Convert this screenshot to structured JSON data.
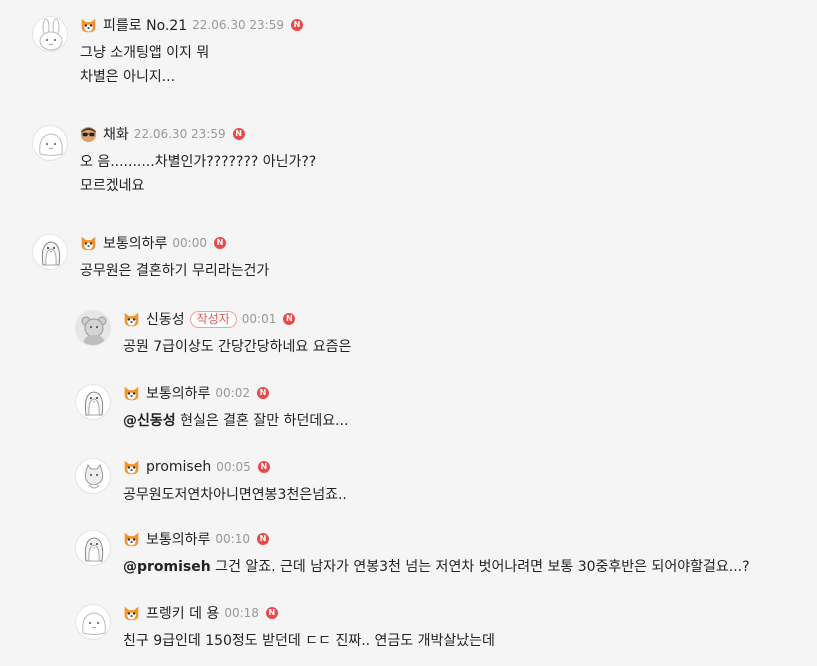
{
  "comments": [
    {
      "nick": "피를로 No.21",
      "date": "22.06.30 23:59",
      "new_badge": "N",
      "lines": [
        "그냥 소개팅앱 이지 뭐",
        "차별은 아니지..."
      ],
      "badge_icon": "corgi-icon",
      "avatar": "rabbit-avatar"
    },
    {
      "nick": "채화",
      "date": "22.06.30 23:59",
      "new_badge": "N",
      "lines": [
        "오 음..........차별인가??????? 아닌가??",
        "모르겠네요"
      ],
      "badge_icon": "sunglasses-icon",
      "avatar": "blob-avatar"
    },
    {
      "nick": "보통의하루",
      "date": "00:00",
      "new_badge": "N",
      "lines": [
        "공무원은 결혼하기 무리라는건가"
      ],
      "badge_icon": "corgi-icon",
      "avatar": "penguin-avatar"
    }
  ],
  "replies": [
    {
      "nick": "신동성",
      "author_tag": "작성자",
      "date": "00:01",
      "new_badge": "N",
      "mention": "",
      "text": "공뭔 7급이상도 간당간당하네요 요즘은",
      "avatar": "bear-avatar"
    },
    {
      "nick": "보통의하루",
      "date": "00:02",
      "new_badge": "N",
      "mention": "@신동성",
      "text": " 현실은 결혼 잘만 하던데요...",
      "avatar": "penguin-avatar"
    },
    {
      "nick": "promiseh",
      "date": "00:05",
      "new_badge": "N",
      "mention": "",
      "text": "공무원도저연차아니면연봉3천은넘죠..",
      "avatar": "cat-avatar"
    },
    {
      "nick": "보통의하루",
      "date": "00:10",
      "new_badge": "N",
      "mention": "@promiseh",
      "text": " 그건 알죠. 근데 남자가 연봉3천 넘는 저연차 벗어나려면 보통 30중후반은 되어야할걸요...?",
      "avatar": "penguin-avatar"
    },
    {
      "nick": "프렝키 데 용",
      "date": "00:18",
      "new_badge": "N",
      "mention": "",
      "text": "친구 9급인데 150정도 받던데 ㄷㄷ 진짜.. 연금도 개박살났는데",
      "avatar": "blob-avatar"
    }
  ],
  "colors": {
    "new_badge": "#e84a4a",
    "author_tag": "#e25b5b",
    "date": "#999999",
    "background": "#f5f5f5"
  }
}
